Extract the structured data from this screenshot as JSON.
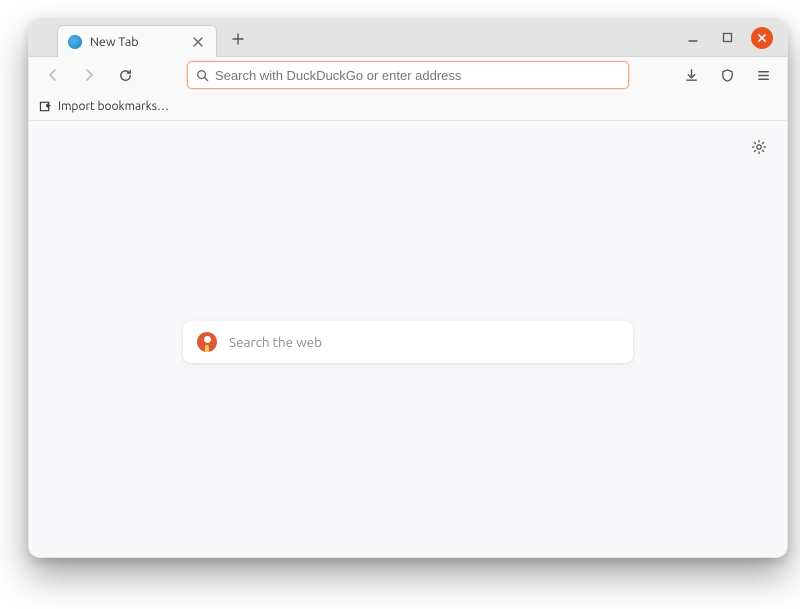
{
  "window": {
    "tab": {
      "title": "New Tab"
    }
  },
  "toolbar": {
    "url_placeholder": "Search with DuckDuckGo or enter address"
  },
  "bookmarks": {
    "import_label": "Import bookmarks…"
  },
  "newtab": {
    "search_placeholder": "Search the web"
  }
}
